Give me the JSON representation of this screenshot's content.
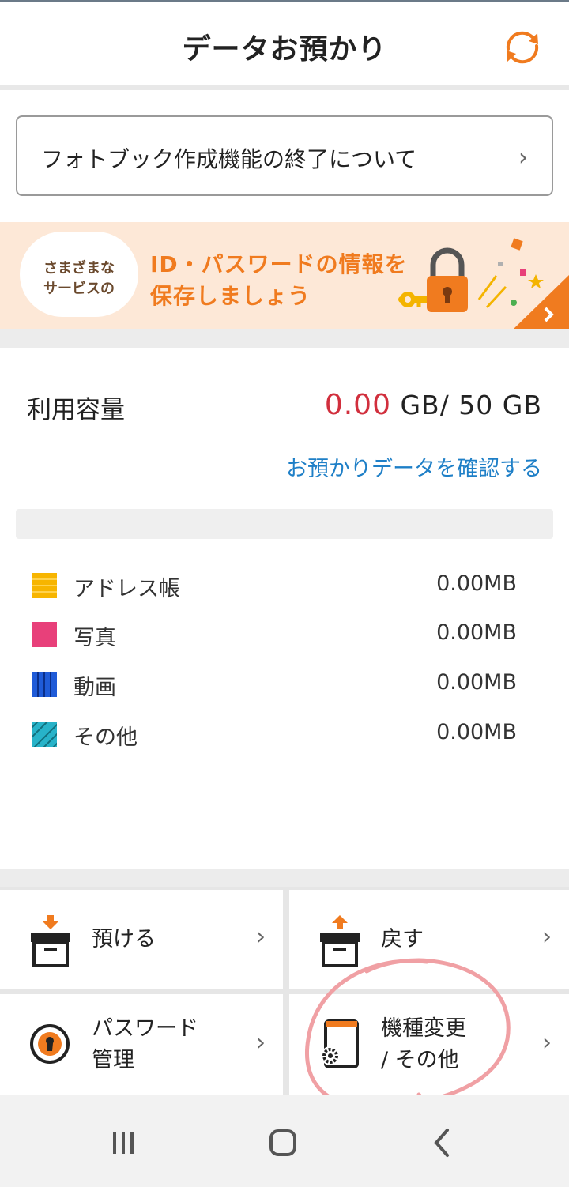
{
  "header": {
    "title": "データお預かり",
    "refresh_icon": "refresh-icon"
  },
  "notice": {
    "text": "フォトブック作成機能の終了について",
    "chevron": "›"
  },
  "banner": {
    "bubble_line1": "さまざまな",
    "bubble_line2": "サービスの",
    "line1": "ID・パスワードの情報を",
    "line2": "保存しましょう",
    "corner_chevron": "›"
  },
  "usage": {
    "label": "利用容量",
    "used": "0.00",
    "rest": " GB/ 50 GB",
    "link": "お預かりデータを確認する",
    "fill_fraction": 0
  },
  "legend": [
    {
      "label": "アドレス帳",
      "value": "0.00MB",
      "color": "#f7b500"
    },
    {
      "label": "写真",
      "value": "0.00MB",
      "color": "#e8407a"
    },
    {
      "label": "動画",
      "value": "0.00MB",
      "color": "#1f5bd8"
    },
    {
      "label": "その他",
      "value": "0.00MB",
      "color": "#27b3c9"
    }
  ],
  "menu": {
    "deposit": {
      "label": "預ける",
      "chevron": "›"
    },
    "restore": {
      "label": "戻す",
      "chevron": "›"
    },
    "password": {
      "line1": "パスワード",
      "line2": "管理",
      "chevron": "›"
    },
    "transfer": {
      "line1": "機種変更",
      "line2": "/ その他",
      "chevron": "›"
    }
  },
  "colors": {
    "accent": "#f07b1f",
    "link": "#1e7fc7",
    "used": "#d12f3d"
  }
}
